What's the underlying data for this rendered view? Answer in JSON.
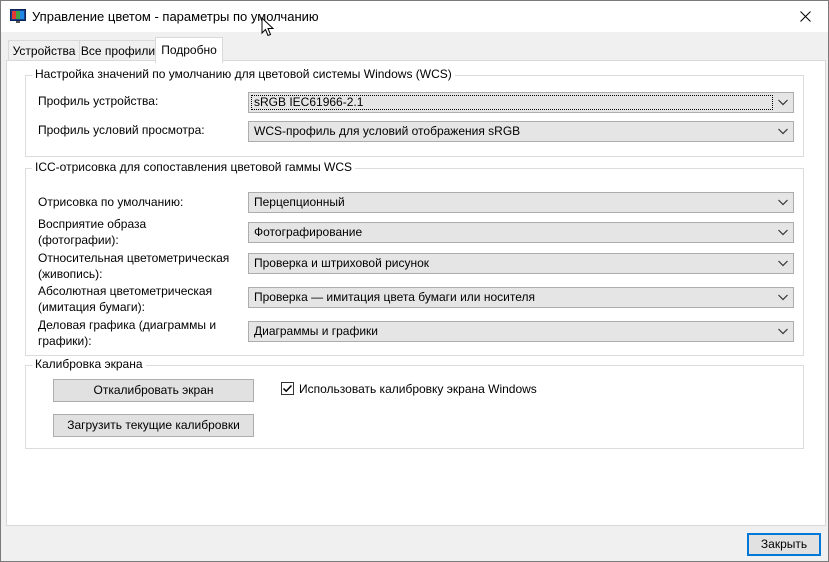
{
  "window": {
    "title": "Управление цветом - параметры по умолчанию"
  },
  "tabs": [
    {
      "label": "Устройства"
    },
    {
      "label": "Все профили"
    },
    {
      "label": "Подробно",
      "active": true
    }
  ],
  "wcs_group": {
    "title": "Настройка значений по умолчанию для цветовой системы Windows (WCS)",
    "device_profile_label": "Профиль устройства:",
    "device_profile_value": "sRGB IEC61966-2.1",
    "viewing_profile_label": "Профиль условий просмотра:",
    "viewing_profile_value": "WCS-профиль для условий отображения sRGB"
  },
  "icc_group": {
    "title": "ICC-отрисовка для сопоставления цветовой гаммы WCS",
    "rows": [
      {
        "label": "Отрисовка по умолчанию:",
        "value": "Перцепционный"
      },
      {
        "label": "Восприятие образа\n(фотографии):",
        "value": "Фотографирование"
      },
      {
        "label": "Относительная цветометрическая\n(живопись):",
        "value": "Проверка и штриховой рисунок"
      },
      {
        "label": "Абсолютная цветометрическая\n(имитация бумаги):",
        "value": "Проверка — имитация цвета бумаги или носителя"
      },
      {
        "label": "Деловая графика (диаграммы и\nграфики):",
        "value": "Диаграммы и графики"
      }
    ]
  },
  "calibration_group": {
    "title": "Калибровка экрана",
    "calibrate_button": "Откалибровать экран",
    "load_button": "Загрузить текущие калибровки",
    "use_windows_calibration_label": "Использовать калибровку экрана Windows",
    "use_windows_calibration_checked": true
  },
  "footer": {
    "close_button": "Закрыть"
  },
  "colors": {
    "accent": "#0078d7",
    "panel_bg": "#ffffff",
    "window_bg": "#f0f0f0"
  }
}
